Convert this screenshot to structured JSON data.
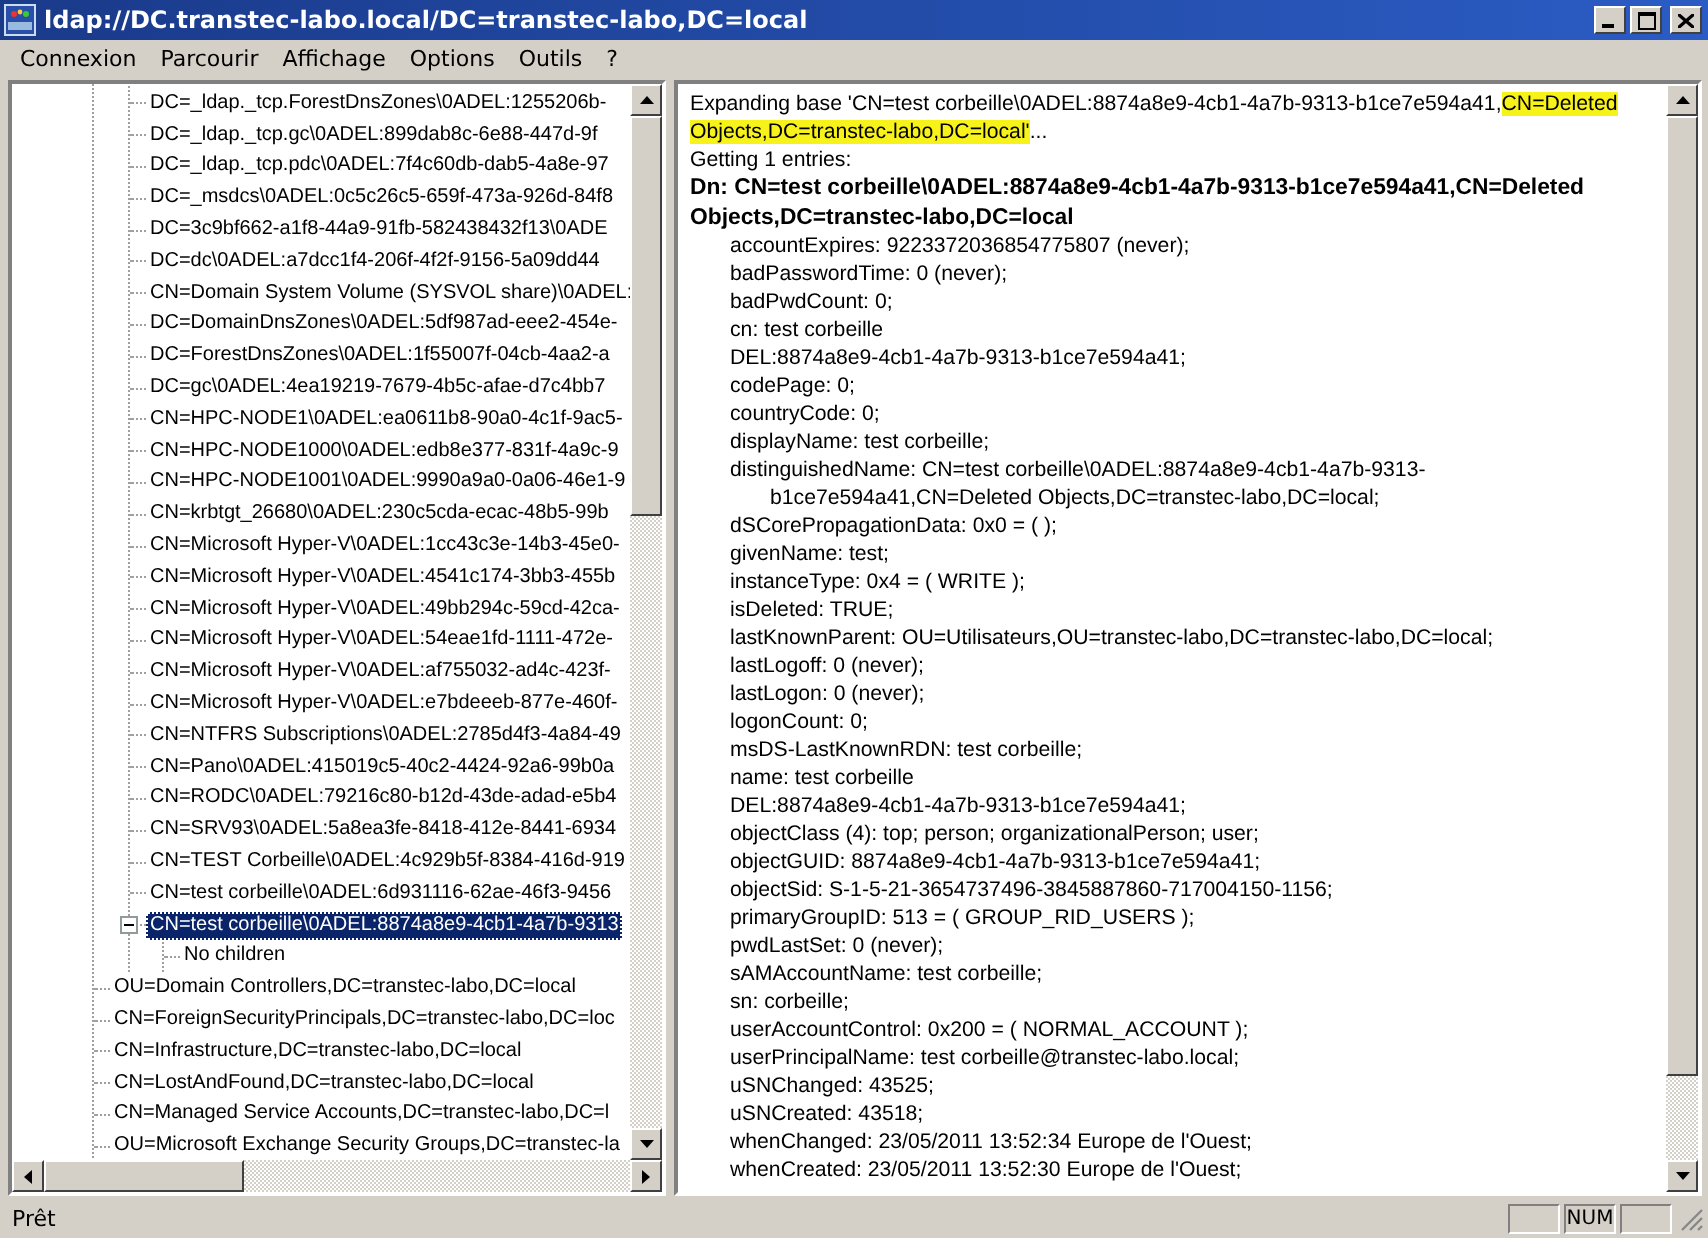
{
  "window": {
    "title": "ldap://DC.transtec-labo.local/DC=transtec-labo,DC=local"
  },
  "menu": [
    "Connexion",
    "Parcourir",
    "Affichage",
    "Options",
    "Outils",
    "?"
  ],
  "tree": {
    "deeper_items": [
      {
        "label": "DC=_ldap._tcp.ForestDnsZones\\0ADEL:1255206b-",
        "selected": false
      },
      {
        "label": "DC=_ldap._tcp.gc\\0ADEL:899dab8c-6e88-447d-9f",
        "selected": false
      },
      {
        "label": "DC=_ldap._tcp.pdc\\0ADEL:7f4c60db-dab5-4a8e-97",
        "selected": false
      },
      {
        "label": "DC=_msdcs\\0ADEL:0c5c26c5-659f-473a-926d-84f8",
        "selected": false
      },
      {
        "label": "DC=3c9bf662-a1f8-44a9-91fb-582438432f13\\0ADE",
        "selected": false
      },
      {
        "label": "DC=dc\\0ADEL:a7dcc1f4-206f-4f2f-9156-5a09dd44",
        "selected": false
      },
      {
        "label": "CN=Domain System Volume (SYSVOL share)\\0ADEL:",
        "selected": false
      },
      {
        "label": "DC=DomainDnsZones\\0ADEL:5df987ad-eee2-454e-",
        "selected": false
      },
      {
        "label": "DC=ForestDnsZones\\0ADEL:1f55007f-04cb-4aa2-a",
        "selected": false
      },
      {
        "label": "DC=gc\\0ADEL:4ea19219-7679-4b5c-afae-d7c4bb7",
        "selected": false
      },
      {
        "label": "CN=HPC-NODE1\\0ADEL:ea0611b8-90a0-4c1f-9ac5-",
        "selected": false
      },
      {
        "label": "CN=HPC-NODE1000\\0ADEL:edb8e377-831f-4a9c-9",
        "selected": false
      },
      {
        "label": "CN=HPC-NODE1001\\0ADEL:9990a9a0-0a06-46e1-9",
        "selected": false
      },
      {
        "label": "CN=krbtgt_26680\\0ADEL:230c5cda-ecac-48b5-99b",
        "selected": false
      },
      {
        "label": "CN=Microsoft Hyper-V\\0ADEL:1cc43c3e-14b3-45e0-",
        "selected": false
      },
      {
        "label": "CN=Microsoft Hyper-V\\0ADEL:4541c174-3bb3-455b",
        "selected": false
      },
      {
        "label": "CN=Microsoft Hyper-V\\0ADEL:49bb294c-59cd-42ca-",
        "selected": false
      },
      {
        "label": "CN=Microsoft Hyper-V\\0ADEL:54eae1fd-1111-472e-",
        "selected": false
      },
      {
        "label": "CN=Microsoft Hyper-V\\0ADEL:af755032-ad4c-423f-",
        "selected": false
      },
      {
        "label": "CN=Microsoft Hyper-V\\0ADEL:e7bdeeeb-877e-460f-",
        "selected": false
      },
      {
        "label": "CN=NTFRS Subscriptions\\0ADEL:2785d4f3-4a84-49",
        "selected": false
      },
      {
        "label": "CN=Pano\\0ADEL:415019c5-40c2-4424-92a6-99b0a",
        "selected": false
      },
      {
        "label": "CN=RODC\\0ADEL:79216c80-b12d-43de-adad-e5b4",
        "selected": false
      },
      {
        "label": "CN=SRV93\\0ADEL:5a8ea3fe-8418-412e-8441-6934",
        "selected": false
      },
      {
        "label": "CN=TEST Corbeille\\0ADEL:4c929b5f-8384-416d-919",
        "selected": false
      },
      {
        "label": "CN=test corbeille\\0ADEL:6d931116-62ae-46f3-9456",
        "selected": false
      },
      {
        "label": "CN=test corbeille\\0ADEL:8874a8e9-4cb1-4a7b-9313",
        "selected": true,
        "expanded": true,
        "children": [
          {
            "label": "No children",
            "selected": false
          }
        ]
      }
    ],
    "items": [
      {
        "label": "OU=Domain Controllers,DC=transtec-labo,DC=local",
        "selected": false
      },
      {
        "label": "CN=ForeignSecurityPrincipals,DC=transtec-labo,DC=loc",
        "selected": false
      },
      {
        "label": "CN=Infrastructure,DC=transtec-labo,DC=local",
        "selected": false
      },
      {
        "label": "CN=LostAndFound,DC=transtec-labo,DC=local",
        "selected": false
      },
      {
        "label": "CN=Managed Service Accounts,DC=transtec-labo,DC=l",
        "selected": false
      },
      {
        "label": "OU=Microsoft Exchange Security Groups,DC=transtec-la",
        "selected": false
      }
    ]
  },
  "output": {
    "expanding": {
      "text": "Expanding base 'CN=test corbeille\\0ADEL:8874a8e9-4cb1-4a7b-9313-b1ce7e594a41,",
      "highlighted": "CN=Deleted Objects,DC=transtec-labo,DC=local'",
      "after": "..."
    },
    "getting": "Getting 1 entries:",
    "dn": "Dn: CN=test corbeille\\0ADEL:8874a8e9-4cb1-4a7b-9313-b1ce7e594a41,CN=Deleted Objects,DC=transtec-labo,DC=local",
    "lines": [
      {
        "kind": "attribute",
        "text": "accountExpires: 9223372036854775807 (never);"
      },
      {
        "kind": "attribute",
        "text": "badPasswordTime: 0 (never);"
      },
      {
        "kind": "attribute",
        "text": "badPwdCount: 0;"
      },
      {
        "kind": "attribute",
        "text": "cn: test corbeille"
      },
      {
        "kind": "attribute",
        "text": "DEL:8874a8e9-4cb1-4a7b-9313-b1ce7e594a41;"
      },
      {
        "kind": "attribute",
        "text": "codePage: 0;"
      },
      {
        "kind": "attribute",
        "text": "countryCode: 0;"
      },
      {
        "kind": "attribute",
        "text": "displayName: test corbeille;"
      },
      {
        "kind": "attribute",
        "text": "distinguishedName: CN=test corbeille\\0ADEL:8874a8e9-4cb1-4a7b-9313-"
      },
      {
        "kind": "wrapped",
        "text": "b1ce7e594a41,CN=Deleted Objects,DC=transtec-labo,DC=local;"
      },
      {
        "kind": "attribute",
        "text": "dSCorePropagationData: 0x0 = (  );"
      },
      {
        "kind": "attribute",
        "text": "givenName: test;"
      },
      {
        "kind": "attribute",
        "text": "instanceType: 0x4 = ( WRITE );"
      },
      {
        "kind": "attribute",
        "text": "isDeleted: TRUE;"
      },
      {
        "kind": "attribute",
        "text": "lastKnownParent: OU=Utilisateurs,OU=transtec-labo,DC=transtec-labo,DC=local;"
      },
      {
        "kind": "attribute",
        "text": "lastLogoff: 0 (never);"
      },
      {
        "kind": "attribute",
        "text": "lastLogon: 0 (never);"
      },
      {
        "kind": "attribute",
        "text": "logonCount: 0;"
      },
      {
        "kind": "attribute",
        "text": "msDS-LastKnownRDN: test corbeille;"
      },
      {
        "kind": "attribute",
        "text": "name: test corbeille"
      },
      {
        "kind": "attribute",
        "text": "DEL:8874a8e9-4cb1-4a7b-9313-b1ce7e594a41;"
      },
      {
        "kind": "attribute",
        "text": "objectClass (4): top; person; organizationalPerson; user;"
      },
      {
        "kind": "attribute",
        "text": "objectGUID: 8874a8e9-4cb1-4a7b-9313-b1ce7e594a41;"
      },
      {
        "kind": "attribute",
        "text": "objectSid: S-1-5-21-3654737496-3845887860-717004150-1156;"
      },
      {
        "kind": "attribute",
        "text": "primaryGroupID: 513 = ( GROUP_RID_USERS );"
      },
      {
        "kind": "attribute",
        "text": "pwdLastSet: 0 (never);"
      },
      {
        "kind": "attribute",
        "text": "sAMAccountName: test corbeille;"
      },
      {
        "kind": "attribute",
        "text": "sn: corbeille;"
      },
      {
        "kind": "attribute",
        "text": "userAccountControl: 0x200 = ( NORMAL_ACCOUNT );"
      },
      {
        "kind": "attribute",
        "text": "userPrincipalName: test corbeille@transtec-labo.local;"
      },
      {
        "kind": "attribute",
        "text": "uSNChanged: 43525;"
      },
      {
        "kind": "attribute",
        "text": "uSNCreated: 43518;"
      },
      {
        "kind": "attribute",
        "text": "whenChanged: 23/05/2011 13:52:34 Europe de l'Ouest;"
      },
      {
        "kind": "attribute",
        "text": "whenCreated: 23/05/2011 13:52:30 Europe de l'Ouest;"
      }
    ]
  },
  "status_bar": {
    "text": "Prêt",
    "num_indicator": "NUM"
  }
}
